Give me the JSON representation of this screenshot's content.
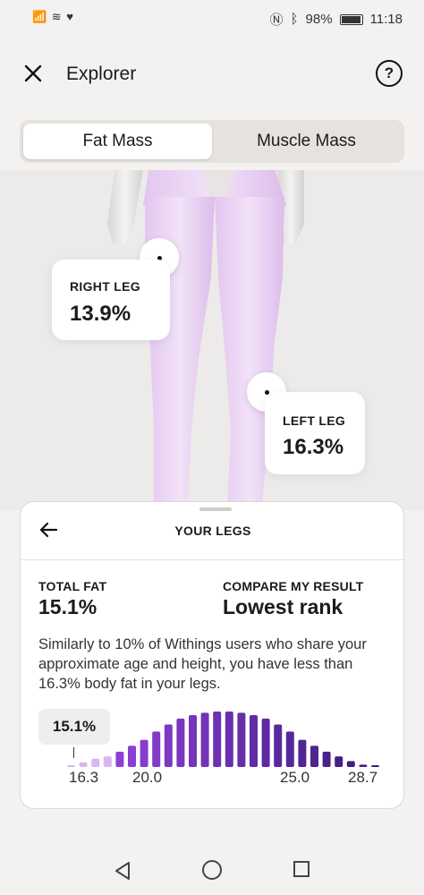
{
  "status_bar": {
    "left_icons": "📶 ≋ ♥",
    "battery": "98%",
    "time": "11:18"
  },
  "header": {
    "title": "Explorer",
    "help": "?"
  },
  "segmented": {
    "options": [
      "Fat Mass",
      "Muscle Mass"
    ],
    "selected": "Fat Mass"
  },
  "callouts": {
    "right_leg": {
      "label": "RIGHT LEG",
      "value": "13.9%"
    },
    "left_leg": {
      "label": "LEFT LEG",
      "value": "16.3%"
    }
  },
  "sheet": {
    "title": "YOUR LEGS",
    "total_fat_label": "TOTAL FAT",
    "total_fat_value": "15.1%",
    "compare_label": "COMPARE MY RESULT",
    "compare_value": "Lowest rank",
    "description": "Similarly to 10% of Withings users who share your approximate age and height, you have less than 16.3% body fat in your legs.",
    "marker_value": "15.1%",
    "axis_labels": [
      "16.3",
      "20.0",
      "25.0",
      "28.7"
    ]
  },
  "chart_data": {
    "type": "bar",
    "values": [
      1,
      4,
      7,
      9,
      13,
      18,
      23,
      30,
      36,
      41,
      44,
      46,
      47,
      47,
      46,
      44,
      41,
      36,
      30,
      23,
      18,
      13,
      9,
      5,
      2,
      1
    ],
    "highlight_count": 4,
    "colors": {
      "low": "#d9b6f0",
      "mid": "#8e3fd6",
      "high": "#3a1b7a"
    }
  }
}
